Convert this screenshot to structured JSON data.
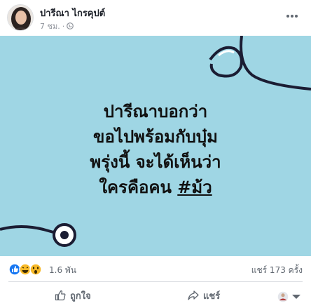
{
  "post": {
    "author_name": "ปารีณา ไกรคุปต์",
    "timestamp": "7 ชม.",
    "separator": "·",
    "privacy_icon": "globe-icon",
    "more_icon": "ellipsis-icon"
  },
  "image": {
    "background_color": "#9fd6e4",
    "text_lines": [
      "ปารีณาบอกว่า",
      "ขอไปพร้อมกับบุ๋ม",
      "พรุ่งนี้ จะได้เห็นว่า",
      "ใครคือคน "
    ],
    "hashtag": "#ม้ว"
  },
  "stats": {
    "reactions": [
      "like",
      "haha",
      "wow"
    ],
    "reaction_count": "1.6 พัน",
    "share_count": "แชร์ 173 ครั้ง"
  },
  "actions": {
    "like_label": "ถูกใจ",
    "share_label": "แชร์"
  },
  "colors": {
    "like_blue": "#1877f2",
    "reaction_yellow": "#f7b928"
  }
}
